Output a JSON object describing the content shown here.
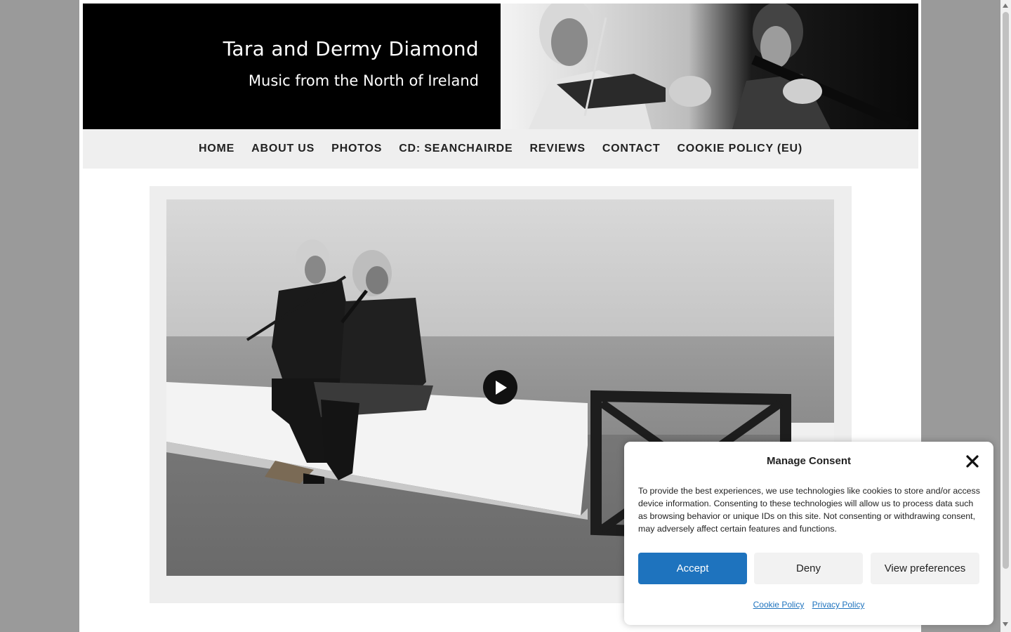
{
  "site": {
    "title": "Tara and Dermy Diamond",
    "tagline": "Music from the North of Ireland"
  },
  "nav": {
    "items": [
      {
        "label": "HOME"
      },
      {
        "label": "ABOUT US"
      },
      {
        "label": "PHOTOS"
      },
      {
        "label": "CD: SEANCHAIRDE"
      },
      {
        "label": "REVIEWS"
      },
      {
        "label": "CONTACT"
      },
      {
        "label": "COOKIE POLICY (EU)"
      }
    ]
  },
  "video": {
    "play_icon": "play-icon"
  },
  "consent": {
    "title": "Manage Consent",
    "text": "To provide the best experiences, we use technologies like cookies to store and/or access device information. Consenting to these technologies will allow us to process data such as browsing behavior or unique IDs on this site. Not consenting or withdrawing consent, may adversely affect certain features and functions.",
    "accept_label": "Accept",
    "deny_label": "Deny",
    "preferences_label": "View preferences",
    "cookie_policy_link": "Cookie Policy",
    "privacy_policy_link": "Privacy Policy",
    "accent_color": "#1e73be"
  }
}
